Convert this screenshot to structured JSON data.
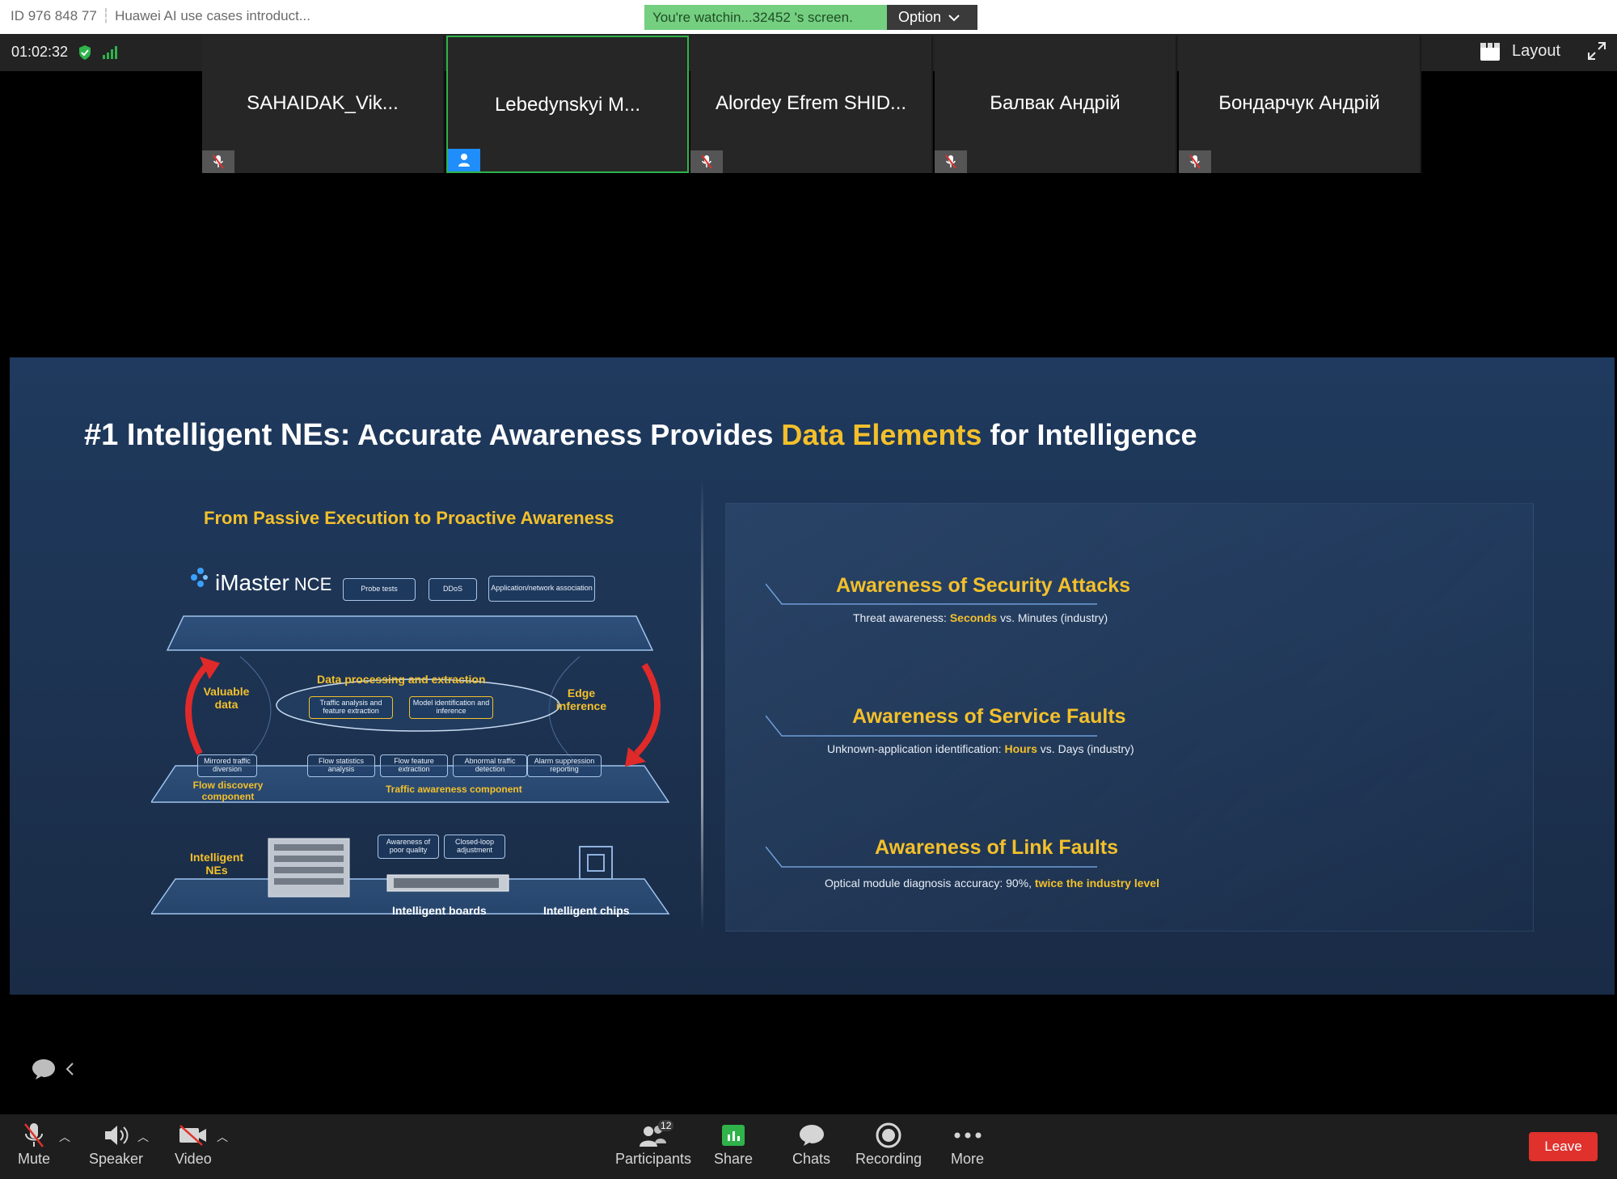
{
  "titlebar": {
    "meeting_id": "ID 976 848 77",
    "meeting_title": "Huawei AI use cases introduct...",
    "watching": "You're watchin...32452 's screen.",
    "option_label": "Option"
  },
  "toolbar_top": {
    "timer": "01:02:32",
    "layout_label": "Layout"
  },
  "participants_strip": [
    {
      "name": "SAHAIDAK_Vik...",
      "muted": true,
      "active": false
    },
    {
      "name": "Lebedynskyi M...",
      "muted": false,
      "active": true
    },
    {
      "name": "Alordey Efrem SHID...",
      "muted": true,
      "active": false
    },
    {
      "name": "Балвак Андрій",
      "muted": true,
      "active": false
    },
    {
      "name": "Бондарчук Андрій",
      "muted": true,
      "active": false
    }
  ],
  "slide": {
    "title_prefix": "#1 Intelligent NEs:",
    "title_part1": " Accurate Awareness Provides ",
    "title_highlight": "Data Elements",
    "title_part2": " for Intelligence",
    "left_heading": "From Passive Execution to Proactive Awareness",
    "diagram": {
      "imaster": "iMaster",
      "nce": "NCE",
      "top_chips": [
        "Probe tests",
        "DDoS",
        "Application/network association"
      ],
      "data_processing": "Data processing and extraction",
      "mid_chips": [
        "Traffic analysis and feature extraction",
        "Model identification and inference"
      ],
      "valuable_data": "Valuable data",
      "edge_inference": "Edge inference",
      "flow_chip": "Mirrored traffic diversion",
      "flow_discovery": "Flow discovery component",
      "traffic_chips": [
        "Flow statistics analysis",
        "Flow feature extraction",
        "Abnormal traffic detection",
        "Alarm suppression reporting"
      ],
      "traffic_component": "Traffic awareness component",
      "intelligent_nes": "Intelligent NEs",
      "board_chips": [
        "Awareness of poor quality",
        "Closed-loop adjustment"
      ],
      "intelligent_boards": "Intelligent boards",
      "intelligent_chips": "Intelligent chips"
    },
    "awareness": [
      {
        "title": "Awareness of Security Attacks",
        "desc_pre": "Threat awareness: ",
        "desc_hl": "Seconds",
        "desc_post": " vs. Minutes (industry)"
      },
      {
        "title": "Awareness of Service Faults",
        "desc_pre": "Unknown-application identification: ",
        "desc_hl": "Hours",
        "desc_post": " vs. Days (industry)"
      },
      {
        "title": "Awareness of Link Faults",
        "desc_pre": "Optical module diagnosis accuracy: 90%, ",
        "desc_hl": "twice the industry level",
        "desc_post": ""
      }
    ]
  },
  "bottom_toolbar": {
    "mute": "Mute",
    "speaker": "Speaker",
    "video": "Video",
    "participants": "Participants",
    "participants_count": "12",
    "share": "Share",
    "chats": "Chats",
    "recording": "Recording",
    "more": "More",
    "leave": "Leave"
  },
  "colors": {
    "accent_yellow": "#f3c02b",
    "banner_green": "#74cf80",
    "active_border": "#2fb34a",
    "leave_red": "#e0312d"
  }
}
